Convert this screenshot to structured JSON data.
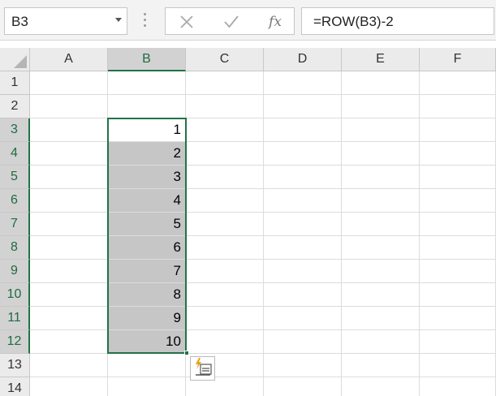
{
  "name_box": {
    "value": "B3"
  },
  "formula_bar": {
    "cancel_icon": "x-cancel-icon",
    "enter_icon": "check-enter-icon",
    "function_label": "fx",
    "formula": "=ROW(B3)-2"
  },
  "columns": [
    "A",
    "B",
    "C",
    "D",
    "E",
    "F"
  ],
  "selected_column": "B",
  "rows": [
    "1",
    "2",
    "3",
    "4",
    "5",
    "6",
    "7",
    "8",
    "9",
    "10",
    "11",
    "12",
    "13",
    "14"
  ],
  "selected_rows": [
    "3",
    "4",
    "5",
    "6",
    "7",
    "8",
    "9",
    "10",
    "11",
    "12"
  ],
  "column_b_values": [
    "",
    "",
    "1",
    "2",
    "3",
    "4",
    "5",
    "6",
    "7",
    "8",
    "9",
    "10",
    "",
    ""
  ],
  "selection": {
    "range": "B3:B12",
    "active_cell": "B3"
  },
  "quick_fill_icon": "flash-fill-options-icon",
  "accent_color": "#217346"
}
